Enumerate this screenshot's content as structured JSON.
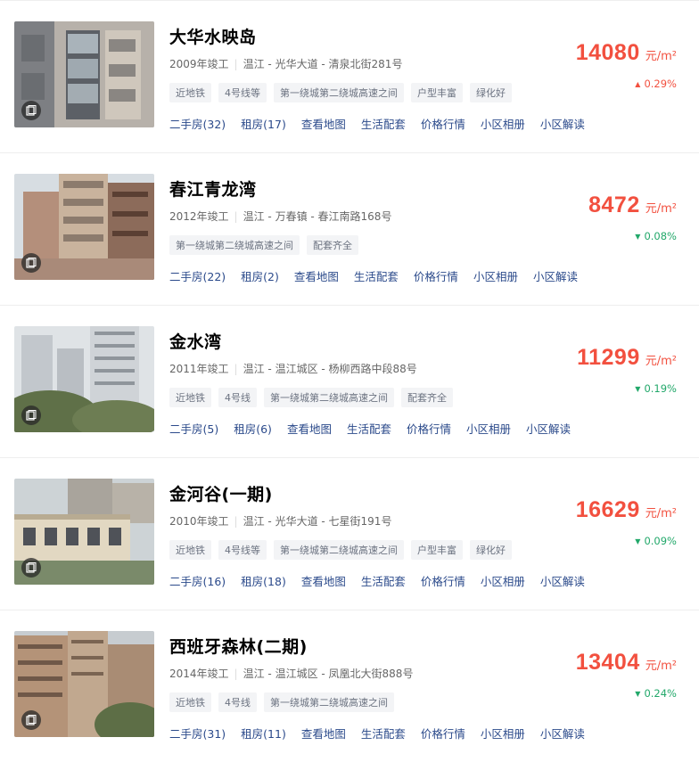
{
  "colors": {
    "price": "#f2503f",
    "down": "#22a86a",
    "link": "#2b4a8b",
    "tag_bg": "#f3f4f6"
  },
  "listings": [
    {
      "name": "大华水映岛",
      "year": "2009年竣工",
      "district": "温江",
      "location": "光华大道 - 清泉北街281号",
      "tags": [
        "近地铁",
        "4号线等",
        "第一绕城第二绕城高速之间",
        "户型丰富",
        "绿化好"
      ],
      "links": [
        "二手房(32)",
        "租房(17)",
        "查看地图",
        "生活配套",
        "价格行情",
        "小区相册",
        "小区解读"
      ],
      "price": "14080",
      "unit": "元/m²",
      "change": "0.29%",
      "direction": "up",
      "arrow": "▲",
      "photo_icon": "photo-album-icon"
    },
    {
      "name": "春江青龙湾",
      "year": "2012年竣工",
      "district": "温江",
      "location": "万春镇 - 春江南路168号",
      "tags": [
        "第一绕城第二绕城高速之间",
        "配套齐全"
      ],
      "links": [
        "二手房(22)",
        "租房(2)",
        "查看地图",
        "生活配套",
        "价格行情",
        "小区相册",
        "小区解读"
      ],
      "price": "8472",
      "unit": "元/m²",
      "change": "0.08%",
      "direction": "down",
      "arrow": "▼",
      "photo_icon": "photo-album-icon"
    },
    {
      "name": "金水湾",
      "year": "2011年竣工",
      "district": "温江",
      "location": "温江城区 - 杨柳西路中段88号",
      "tags": [
        "近地铁",
        "4号线",
        "第一绕城第二绕城高速之间",
        "配套齐全"
      ],
      "links": [
        "二手房(5)",
        "租房(6)",
        "查看地图",
        "生活配套",
        "价格行情",
        "小区相册",
        "小区解读"
      ],
      "price": "11299",
      "unit": "元/m²",
      "change": "0.19%",
      "direction": "down",
      "arrow": "▼",
      "photo_icon": "photo-album-icon"
    },
    {
      "name": "金河谷(一期)",
      "year": "2010年竣工",
      "district": "温江",
      "location": "光华大道 - 七星街191号",
      "tags": [
        "近地铁",
        "4号线等",
        "第一绕城第二绕城高速之间",
        "户型丰富",
        "绿化好"
      ],
      "links": [
        "二手房(16)",
        "租房(18)",
        "查看地图",
        "生活配套",
        "价格行情",
        "小区相册",
        "小区解读"
      ],
      "price": "16629",
      "unit": "元/m²",
      "change": "0.09%",
      "direction": "down",
      "arrow": "▼",
      "photo_icon": "photo-album-icon"
    },
    {
      "name": "西班牙森林(二期)",
      "year": "2014年竣工",
      "district": "温江",
      "location": "温江城区 - 凤凰北大街888号",
      "tags": [
        "近地铁",
        "4号线",
        "第一绕城第二绕城高速之间"
      ],
      "links": [
        "二手房(31)",
        "租房(11)",
        "查看地图",
        "生活配套",
        "价格行情",
        "小区相册",
        "小区解读"
      ],
      "price": "13404",
      "unit": "元/m²",
      "change": "0.24%",
      "direction": "down",
      "arrow": "▼",
      "photo_icon": "photo-album-icon"
    }
  ]
}
